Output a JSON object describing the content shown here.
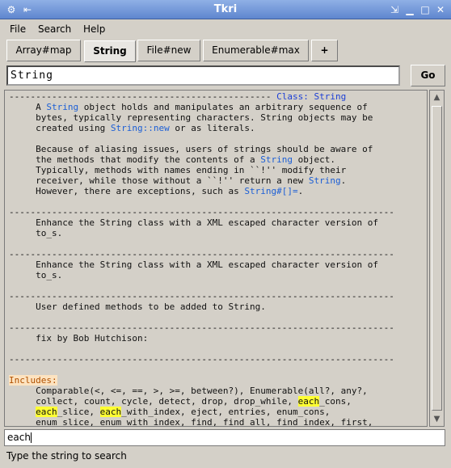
{
  "window": {
    "title": "Tkri"
  },
  "menubar": {
    "file": "File",
    "search": "Search",
    "help": "Help"
  },
  "tabs": [
    {
      "label": "Array#map"
    },
    {
      "label": "String"
    },
    {
      "label": "File#new"
    },
    {
      "label": "Enumerable#max"
    },
    {
      "label": "+"
    }
  ],
  "search": {
    "query": "String",
    "go_label": "Go"
  },
  "doc": {
    "header_dashes": "-------------------------------------------------",
    "class_label": "Class: String",
    "p1_l1a": "     A ",
    "p1_l1b": "String",
    "p1_l1c": " object holds and manipulates an arbitrary sequence of",
    "p1_l2": "     bytes, typically representing characters. String objects may be",
    "p1_l3a": "     created using ",
    "p1_l3b": "String::new",
    "p1_l3c": " or as literals.",
    "p2_l1": "     Because of aliasing issues, users of strings should be aware of",
    "p2_l2a": "     the methods that modify the contents of a ",
    "p2_l2b": "String",
    "p2_l2c": " object.",
    "p2_l3": "     Typically, methods with names ending in ``!'' modify their",
    "p2_l4a": "     receiver, while those without a ``!'' return a new ",
    "p2_l4b": "String",
    "p2_l4c": ".",
    "p2_l5a": "     However, there are exceptions, such as ",
    "p2_l5b": "String#[]=",
    "p2_l5c": ".",
    "sep": "------------------------------------------------------------------------",
    "s1_l1": "     Enhance the String class with a XML escaped character version of",
    "s1_l2": "     to_s.",
    "s2_l1": "     Enhance the String class with a XML escaped character version of",
    "s2_l2": "     to_s.",
    "s3_l1": "     User defined methods to be added to String.",
    "s4_l1": "     fix by Bob Hutchison:",
    "includes_label": "Includes:",
    "inc_l1": "     Comparable(<, <=, ==, >, >=, between?), Enumerable(all?, any?,",
    "inc_l2a": "     collect, count, cycle, detect, drop, drop_while, ",
    "inc_l2b": "each",
    "inc_l2c": "_cons,",
    "inc_l3a": "     ",
    "inc_l3b": "each",
    "inc_l3c": "_slice, ",
    "inc_l3d": "each",
    "inc_l3e": "_with_index, eject, entries, enum_cons,",
    "inc_l4": "     enum_slice, enum_with_index, find, find_all, find_index, first,"
  },
  "find": {
    "value": "each"
  },
  "status": {
    "text": "Type the string to search"
  }
}
